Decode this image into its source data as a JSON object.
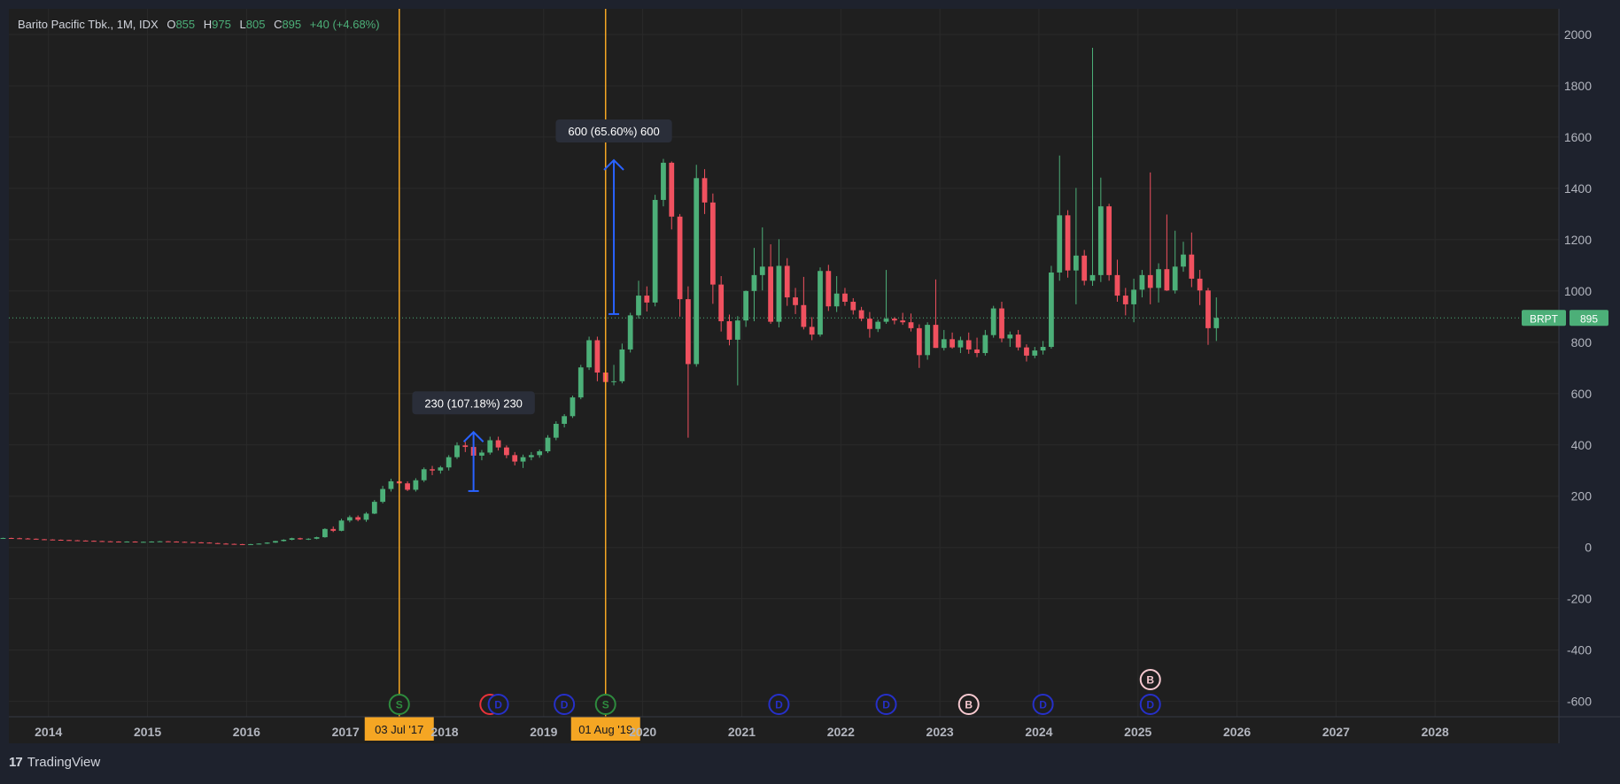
{
  "header": {
    "symbol": "Barito Pacific Tbk., 1M, IDX",
    "o_label": "O",
    "o_value": "855",
    "h_label": "H",
    "h_value": "975",
    "l_label": "L",
    "l_value": "805",
    "c_label": "C",
    "c_value": "895",
    "change": "+40 (+4.68%)"
  },
  "branding": {
    "logo_glyph": "17",
    "name": "TradingView"
  },
  "price_tag": {
    "ticker": "BRPT",
    "price": "895"
  },
  "colors": {
    "background": "#1e222d",
    "pane": "#1f1f1f",
    "up": "#4caf78",
    "down": "#f0515f",
    "grid": "#2a2a2a",
    "measure": "#2962ff",
    "vline": "#f5a623",
    "axis_text": "#b2b5be",
    "price_tag": "#4caf78"
  },
  "chart_data": {
    "type": "candlestick",
    "title": "Barito Pacific Tbk., 1M, IDX",
    "interval": "1M",
    "y_ticks": [
      2000,
      1800,
      1600,
      1400,
      1200,
      1000,
      800,
      600,
      400,
      200,
      0,
      -200,
      -400,
      -600
    ],
    "ylim": [
      -660,
      2100
    ],
    "x_ticks": [
      "2014",
      "2015",
      "2016",
      "2017",
      "2018",
      "2019",
      "2020",
      "2021",
      "2022",
      "2023",
      "2024",
      "2025",
      "2026",
      "2027",
      "2028"
    ],
    "xlim": [
      2013.6,
      2029.25
    ],
    "grid": true,
    "current_price": 895,
    "series": [
      {
        "t": "2013-07",
        "o": 36,
        "h": 38,
        "l": 34,
        "c": 37
      },
      {
        "t": "2013-08",
        "o": 37,
        "h": 38,
        "l": 35,
        "c": 36
      },
      {
        "t": "2013-09",
        "o": 36,
        "h": 38,
        "l": 34,
        "c": 35
      },
      {
        "t": "2013-10",
        "o": 35,
        "h": 37,
        "l": 33,
        "c": 34
      },
      {
        "t": "2013-11",
        "o": 34,
        "h": 35,
        "l": 31,
        "c": 32
      },
      {
        "t": "2013-12",
        "o": 32,
        "h": 33,
        "l": 30,
        "c": 31
      },
      {
        "t": "2014-01",
        "o": 31,
        "h": 32,
        "l": 29,
        "c": 30
      },
      {
        "t": "2014-02",
        "o": 30,
        "h": 31,
        "l": 28,
        "c": 29
      },
      {
        "t": "2014-03",
        "o": 29,
        "h": 30,
        "l": 27,
        "c": 28
      },
      {
        "t": "2014-04",
        "o": 28,
        "h": 29,
        "l": 26,
        "c": 27
      },
      {
        "t": "2014-05",
        "o": 27,
        "h": 28,
        "l": 25,
        "c": 26
      },
      {
        "t": "2014-06",
        "o": 26,
        "h": 27,
        "l": 24,
        "c": 25
      },
      {
        "t": "2014-07",
        "o": 25,
        "h": 26,
        "l": 23,
        "c": 24
      },
      {
        "t": "2014-08",
        "o": 24,
        "h": 25,
        "l": 22,
        "c": 23
      },
      {
        "t": "2014-09",
        "o": 23,
        "h": 24,
        "l": 21,
        "c": 22
      },
      {
        "t": "2014-10",
        "o": 22,
        "h": 24,
        "l": 21,
        "c": 23
      },
      {
        "t": "2014-11",
        "o": 23,
        "h": 24,
        "l": 21,
        "c": 22
      },
      {
        "t": "2014-12",
        "o": 22,
        "h": 23,
        "l": 21,
        "c": 22
      },
      {
        "t": "2015-01",
        "o": 22,
        "h": 24,
        "l": 21,
        "c": 23
      },
      {
        "t": "2015-02",
        "o": 23,
        "h": 25,
        "l": 22,
        "c": 24
      },
      {
        "t": "2015-03",
        "o": 24,
        "h": 25,
        "l": 22,
        "c": 23
      },
      {
        "t": "2015-04",
        "o": 23,
        "h": 24,
        "l": 22,
        "c": 22
      },
      {
        "t": "2015-05",
        "o": 22,
        "h": 23,
        "l": 21,
        "c": 21
      },
      {
        "t": "2015-06",
        "o": 21,
        "h": 22,
        "l": 19,
        "c": 20
      },
      {
        "t": "2015-07",
        "o": 20,
        "h": 21,
        "l": 18,
        "c": 19
      },
      {
        "t": "2015-08",
        "o": 19,
        "h": 20,
        "l": 16,
        "c": 17
      },
      {
        "t": "2015-09",
        "o": 17,
        "h": 18,
        "l": 14,
        "c": 15
      },
      {
        "t": "2015-10",
        "o": 15,
        "h": 17,
        "l": 13,
        "c": 14
      },
      {
        "t": "2015-11",
        "o": 14,
        "h": 15,
        "l": 12,
        "c": 13
      },
      {
        "t": "2015-12",
        "o": 13,
        "h": 14,
        "l": 11,
        "c": 12
      },
      {
        "t": "2016-01",
        "o": 12,
        "h": 14,
        "l": 11,
        "c": 13
      },
      {
        "t": "2016-02",
        "o": 13,
        "h": 16,
        "l": 12,
        "c": 15
      },
      {
        "t": "2016-03",
        "o": 15,
        "h": 20,
        "l": 14,
        "c": 19
      },
      {
        "t": "2016-04",
        "o": 19,
        "h": 26,
        "l": 18,
        "c": 25
      },
      {
        "t": "2016-05",
        "o": 25,
        "h": 32,
        "l": 23,
        "c": 30
      },
      {
        "t": "2016-06",
        "o": 30,
        "h": 38,
        "l": 28,
        "c": 36
      },
      {
        "t": "2016-07",
        "o": 36,
        "h": 38,
        "l": 30,
        "c": 32
      },
      {
        "t": "2016-08",
        "o": 32,
        "h": 36,
        "l": 29,
        "c": 34
      },
      {
        "t": "2016-09",
        "o": 34,
        "h": 42,
        "l": 32,
        "c": 40
      },
      {
        "t": "2016-10",
        "o": 40,
        "h": 75,
        "l": 38,
        "c": 72
      },
      {
        "t": "2016-11",
        "o": 72,
        "h": 82,
        "l": 60,
        "c": 65
      },
      {
        "t": "2016-12",
        "o": 65,
        "h": 112,
        "l": 63,
        "c": 105
      },
      {
        "t": "2017-01",
        "o": 105,
        "h": 125,
        "l": 98,
        "c": 118
      },
      {
        "t": "2017-02",
        "o": 118,
        "h": 125,
        "l": 102,
        "c": 108
      },
      {
        "t": "2017-03",
        "o": 108,
        "h": 138,
        "l": 100,
        "c": 132
      },
      {
        "t": "2017-04",
        "o": 132,
        "h": 185,
        "l": 130,
        "c": 178
      },
      {
        "t": "2017-05",
        "o": 178,
        "h": 240,
        "l": 172,
        "c": 228
      },
      {
        "t": "2017-06",
        "o": 228,
        "h": 268,
        "l": 218,
        "c": 258
      },
      {
        "t": "2017-07",
        "o": 258,
        "h": 275,
        "l": 238,
        "c": 250
      },
      {
        "t": "2017-08",
        "o": 250,
        "h": 258,
        "l": 220,
        "c": 225
      },
      {
        "t": "2017-09",
        "o": 225,
        "h": 270,
        "l": 218,
        "c": 262
      },
      {
        "t": "2017-10",
        "o": 262,
        "h": 312,
        "l": 255,
        "c": 305
      },
      {
        "t": "2017-11",
        "o": 305,
        "h": 318,
        "l": 282,
        "c": 300
      },
      {
        "t": "2017-12",
        "o": 300,
        "h": 318,
        "l": 288,
        "c": 312
      },
      {
        "t": "2018-01",
        "o": 312,
        "h": 360,
        "l": 300,
        "c": 352
      },
      {
        "t": "2018-02",
        "o": 352,
        "h": 410,
        "l": 345,
        "c": 398
      },
      {
        "t": "2018-03",
        "o": 398,
        "h": 412,
        "l": 372,
        "c": 392
      },
      {
        "t": "2018-04",
        "o": 392,
        "h": 418,
        "l": 350,
        "c": 358
      },
      {
        "t": "2018-05",
        "o": 358,
        "h": 380,
        "l": 340,
        "c": 370
      },
      {
        "t": "2018-06",
        "o": 370,
        "h": 432,
        "l": 362,
        "c": 418
      },
      {
        "t": "2018-07",
        "o": 418,
        "h": 432,
        "l": 378,
        "c": 390
      },
      {
        "t": "2018-08",
        "o": 390,
        "h": 398,
        "l": 348,
        "c": 360
      },
      {
        "t": "2018-09",
        "o": 360,
        "h": 372,
        "l": 320,
        "c": 335
      },
      {
        "t": "2018-10",
        "o": 335,
        "h": 362,
        "l": 310,
        "c": 352
      },
      {
        "t": "2018-11",
        "o": 352,
        "h": 372,
        "l": 340,
        "c": 360
      },
      {
        "t": "2018-12",
        "o": 360,
        "h": 382,
        "l": 350,
        "c": 375
      },
      {
        "t": "2019-01",
        "o": 375,
        "h": 438,
        "l": 368,
        "c": 428
      },
      {
        "t": "2019-02",
        "o": 428,
        "h": 492,
        "l": 418,
        "c": 482
      },
      {
        "t": "2019-03",
        "o": 482,
        "h": 520,
        "l": 468,
        "c": 512
      },
      {
        "t": "2019-04",
        "o": 512,
        "h": 592,
        "l": 505,
        "c": 585
      },
      {
        "t": "2019-05",
        "o": 585,
        "h": 712,
        "l": 578,
        "c": 702
      },
      {
        "t": "2019-06",
        "o": 702,
        "h": 822,
        "l": 692,
        "c": 808
      },
      {
        "t": "2019-07",
        "o": 808,
        "h": 822,
        "l": 648,
        "c": 682
      },
      {
        "t": "2019-08",
        "o": 682,
        "h": 712,
        "l": 628,
        "c": 645
      },
      {
        "t": "2019-09",
        "o": 645,
        "h": 712,
        "l": 632,
        "c": 648
      },
      {
        "t": "2019-10",
        "o": 648,
        "h": 795,
        "l": 640,
        "c": 772
      },
      {
        "t": "2019-11",
        "o": 772,
        "h": 915,
        "l": 760,
        "c": 905
      },
      {
        "t": "2019-12",
        "o": 905,
        "h": 1040,
        "l": 892,
        "c": 982
      },
      {
        "t": "2020-01",
        "o": 982,
        "h": 1018,
        "l": 920,
        "c": 955
      },
      {
        "t": "2020-02",
        "o": 955,
        "h": 1375,
        "l": 940,
        "c": 1355
      },
      {
        "t": "2020-03",
        "o": 1355,
        "h": 1515,
        "l": 1330,
        "c": 1500
      },
      {
        "t": "2020-04",
        "o": 1500,
        "h": 1505,
        "l": 1240,
        "c": 1290
      },
      {
        "t": "2020-05",
        "o": 1290,
        "h": 1300,
        "l": 900,
        "c": 968
      },
      {
        "t": "2020-06",
        "o": 968,
        "h": 1018,
        "l": 428,
        "c": 715
      },
      {
        "t": "2020-07",
        "o": 715,
        "h": 1492,
        "l": 705,
        "c": 1440
      },
      {
        "t": "2020-08",
        "o": 1440,
        "h": 1475,
        "l": 1300,
        "c": 1345
      },
      {
        "t": "2020-09",
        "o": 1345,
        "h": 1380,
        "l": 950,
        "c": 1025
      },
      {
        "t": "2020-10",
        "o": 1025,
        "h": 1058,
        "l": 842,
        "c": 882
      },
      {
        "t": "2020-11",
        "o": 882,
        "h": 908,
        "l": 788,
        "c": 810
      },
      {
        "t": "2020-12",
        "o": 810,
        "h": 902,
        "l": 632,
        "c": 885
      },
      {
        "t": "2021-01",
        "o": 885,
        "h": 1002,
        "l": 860,
        "c": 1000
      },
      {
        "t": "2021-02",
        "o": 1000,
        "h": 1168,
        "l": 882,
        "c": 1062
      },
      {
        "t": "2021-03",
        "o": 1062,
        "h": 1248,
        "l": 1002,
        "c": 1095
      },
      {
        "t": "2021-04",
        "o": 1095,
        "h": 1182,
        "l": 872,
        "c": 880
      },
      {
        "t": "2021-05",
        "o": 880,
        "h": 1202,
        "l": 858,
        "c": 1098
      },
      {
        "t": "2021-06",
        "o": 1098,
        "h": 1128,
        "l": 942,
        "c": 975
      },
      {
        "t": "2021-07",
        "o": 975,
        "h": 1012,
        "l": 910,
        "c": 945
      },
      {
        "t": "2021-08",
        "o": 945,
        "h": 1055,
        "l": 850,
        "c": 860
      },
      {
        "t": "2021-09",
        "o": 860,
        "h": 898,
        "l": 808,
        "c": 830
      },
      {
        "t": "2021-10",
        "o": 830,
        "h": 1092,
        "l": 822,
        "c": 1078
      },
      {
        "t": "2021-11",
        "o": 1078,
        "h": 1102,
        "l": 922,
        "c": 940
      },
      {
        "t": "2021-12",
        "o": 940,
        "h": 1058,
        "l": 918,
        "c": 990
      },
      {
        "t": "2022-01",
        "o": 990,
        "h": 1012,
        "l": 942,
        "c": 958
      },
      {
        "t": "2022-02",
        "o": 958,
        "h": 972,
        "l": 908,
        "c": 925
      },
      {
        "t": "2022-03",
        "o": 925,
        "h": 938,
        "l": 882,
        "c": 892
      },
      {
        "t": "2022-04",
        "o": 892,
        "h": 918,
        "l": 818,
        "c": 852
      },
      {
        "t": "2022-05",
        "o": 852,
        "h": 888,
        "l": 840,
        "c": 880
      },
      {
        "t": "2022-06",
        "o": 880,
        "h": 1082,
        "l": 872,
        "c": 892
      },
      {
        "t": "2022-07",
        "o": 892,
        "h": 898,
        "l": 870,
        "c": 885
      },
      {
        "t": "2022-08",
        "o": 885,
        "h": 915,
        "l": 868,
        "c": 878
      },
      {
        "t": "2022-09",
        "o": 878,
        "h": 912,
        "l": 842,
        "c": 855
      },
      {
        "t": "2022-10",
        "o": 855,
        "h": 870,
        "l": 700,
        "c": 750
      },
      {
        "t": "2022-11",
        "o": 750,
        "h": 878,
        "l": 732,
        "c": 868
      },
      {
        "t": "2022-12",
        "o": 868,
        "h": 1045,
        "l": 778,
        "c": 778
      },
      {
        "t": "2023-01",
        "o": 778,
        "h": 848,
        "l": 768,
        "c": 812
      },
      {
        "t": "2023-02",
        "o": 812,
        "h": 838,
        "l": 775,
        "c": 780
      },
      {
        "t": "2023-03",
        "o": 780,
        "h": 822,
        "l": 758,
        "c": 808
      },
      {
        "t": "2023-04",
        "o": 808,
        "h": 838,
        "l": 755,
        "c": 772
      },
      {
        "t": "2023-05",
        "o": 772,
        "h": 818,
        "l": 742,
        "c": 758
      },
      {
        "t": "2023-06",
        "o": 758,
        "h": 848,
        "l": 748,
        "c": 828
      },
      {
        "t": "2023-07",
        "o": 828,
        "h": 942,
        "l": 818,
        "c": 932
      },
      {
        "t": "2023-08",
        "o": 932,
        "h": 958,
        "l": 800,
        "c": 815
      },
      {
        "t": "2023-09",
        "o": 815,
        "h": 842,
        "l": 782,
        "c": 830
      },
      {
        "t": "2023-10",
        "o": 830,
        "h": 848,
        "l": 768,
        "c": 780
      },
      {
        "t": "2023-11",
        "o": 780,
        "h": 792,
        "l": 725,
        "c": 748
      },
      {
        "t": "2023-12",
        "o": 748,
        "h": 782,
        "l": 738,
        "c": 768
      },
      {
        "t": "2024-01",
        "o": 768,
        "h": 805,
        "l": 752,
        "c": 782
      },
      {
        "t": "2024-02",
        "o": 782,
        "h": 1098,
        "l": 775,
        "c": 1072
      },
      {
        "t": "2024-03",
        "o": 1072,
        "h": 1528,
        "l": 1040,
        "c": 1295
      },
      {
        "t": "2024-04",
        "o": 1295,
        "h": 1315,
        "l": 1052,
        "c": 1080
      },
      {
        "t": "2024-05",
        "o": 1080,
        "h": 1402,
        "l": 948,
        "c": 1138
      },
      {
        "t": "2024-06",
        "o": 1138,
        "h": 1160,
        "l": 1022,
        "c": 1040
      },
      {
        "t": "2024-07",
        "o": 1040,
        "h": 1948,
        "l": 1020,
        "c": 1062
      },
      {
        "t": "2024-08",
        "o": 1062,
        "h": 1442,
        "l": 1035,
        "c": 1330
      },
      {
        "t": "2024-09",
        "o": 1330,
        "h": 1340,
        "l": 1040,
        "c": 1062
      },
      {
        "t": "2024-10",
        "o": 1062,
        "h": 1122,
        "l": 958,
        "c": 982
      },
      {
        "t": "2024-11",
        "o": 982,
        "h": 1012,
        "l": 905,
        "c": 948
      },
      {
        "t": "2024-12",
        "o": 948,
        "h": 1048,
        "l": 878,
        "c": 1005
      },
      {
        "t": "2025-01",
        "o": 1005,
        "h": 1082,
        "l": 975,
        "c": 1062
      },
      {
        "t": "2025-02",
        "o": 1062,
        "h": 1462,
        "l": 948,
        "c": 1012
      },
      {
        "t": "2025-03",
        "o": 1012,
        "h": 1108,
        "l": 955,
        "c": 1085
      },
      {
        "t": "2025-04",
        "o": 1085,
        "h": 1298,
        "l": 1000,
        "c": 1002
      },
      {
        "t": "2025-05",
        "o": 1002,
        "h": 1235,
        "l": 990,
        "c": 1095
      },
      {
        "t": "2025-06",
        "o": 1095,
        "h": 1192,
        "l": 1075,
        "c": 1142
      },
      {
        "t": "2025-07",
        "o": 1142,
        "h": 1228,
        "l": 1015,
        "c": 1048
      },
      {
        "t": "2025-08",
        "o": 1048,
        "h": 1082,
        "l": 945,
        "c": 1002
      },
      {
        "t": "2025-09",
        "o": 1002,
        "h": 1012,
        "l": 790,
        "c": 855
      },
      {
        "t": "2025-10",
        "o": 855,
        "h": 975,
        "l": 805,
        "c": 895
      }
    ],
    "measurements": [
      {
        "at": "2018-04",
        "from": 220,
        "to": 450,
        "label": "230 (107.18%) 230"
      },
      {
        "at": "2019-09",
        "from": 910,
        "to": 1510,
        "label": "600 (65.60%) 600"
      }
    ],
    "vertical_lines": [
      {
        "at": "2017-07",
        "label": "03 Jul '17"
      },
      {
        "at": "2019-08",
        "label": "01 Aug '19"
      }
    ],
    "events": [
      {
        "at": "2017-07",
        "glyph": "S",
        "kind": "split",
        "row": 0
      },
      {
        "at": "2018-06",
        "glyph": "",
        "kind": "earnings",
        "row": 0
      },
      {
        "at": "2018-07",
        "glyph": "D",
        "kind": "dividend",
        "row": 0
      },
      {
        "at": "2019-03",
        "glyph": "D",
        "kind": "dividend",
        "row": 0
      },
      {
        "at": "2019-08",
        "glyph": "S",
        "kind": "split",
        "row": 0
      },
      {
        "at": "2021-05",
        "glyph": "D",
        "kind": "dividend",
        "row": 0
      },
      {
        "at": "2022-06",
        "glyph": "D",
        "kind": "dividend",
        "row": 0
      },
      {
        "at": "2023-04",
        "glyph": "B",
        "kind": "buyback",
        "row": 0
      },
      {
        "at": "2024-01",
        "glyph": "D",
        "kind": "dividend",
        "row": 0
      },
      {
        "at": "2025-02",
        "glyph": "D",
        "kind": "dividend",
        "row": 0
      },
      {
        "at": "2025-02",
        "glyph": "B",
        "kind": "buyback",
        "row": 1
      }
    ]
  }
}
